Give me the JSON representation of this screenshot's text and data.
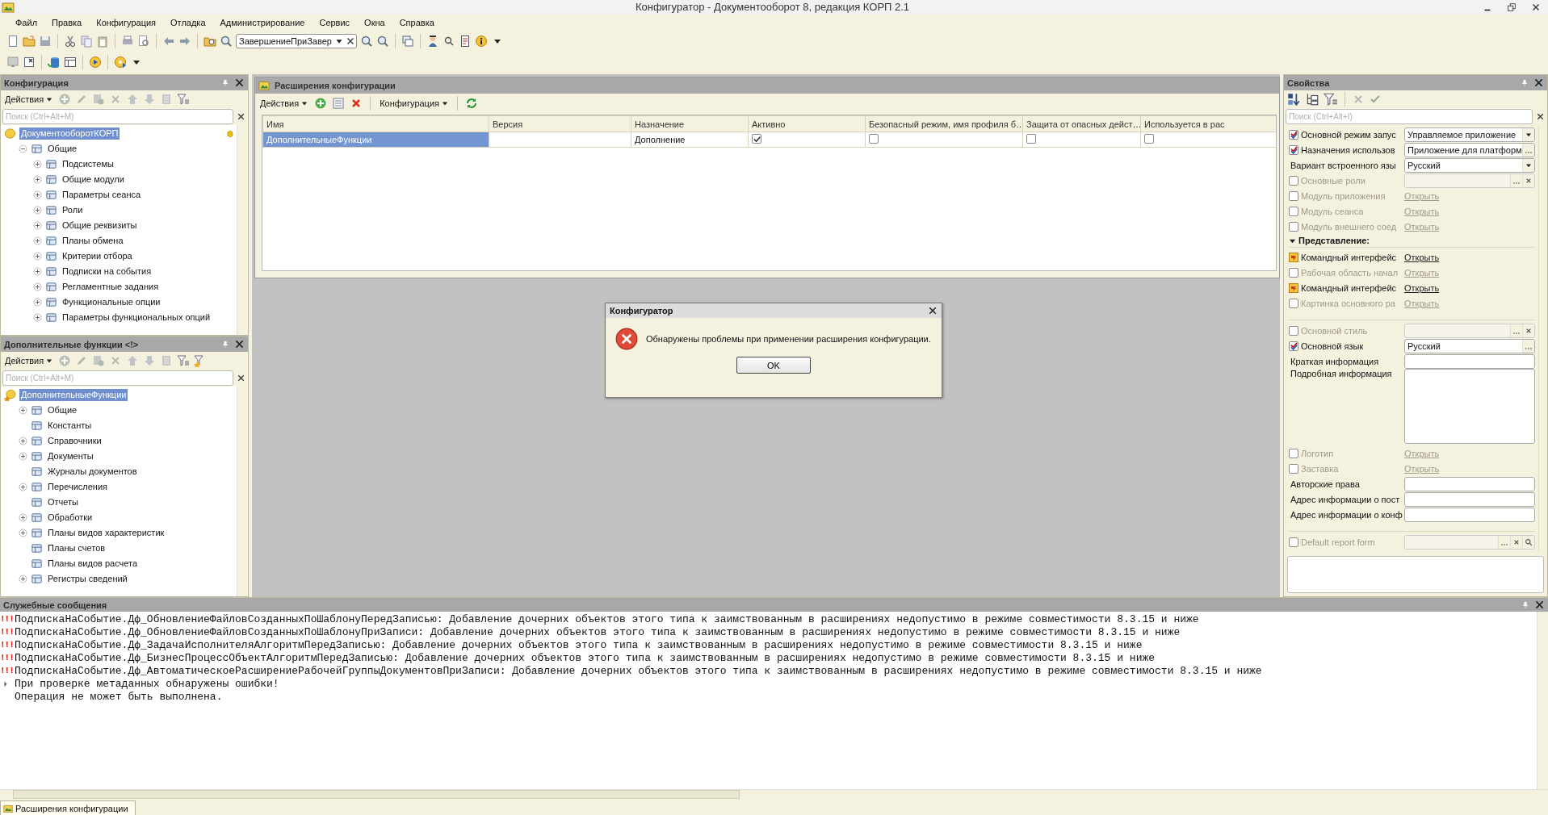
{
  "window": {
    "title": "Конфигуратор - Документооборот 8, редакция КОРП 2.1"
  },
  "menu": [
    "Файл",
    "Правка",
    "Конфигурация",
    "Отладка",
    "Администрирование",
    "Сервис",
    "Окна",
    "Справка"
  ],
  "toolbar": {
    "search": {
      "value": "ЗавершениеПриЗавер"
    }
  },
  "config_panel": {
    "title": "Конфигурация",
    "actions": "Действия",
    "search": {
      "placeholder": "Поиск (Ctrl+Alt+M)"
    },
    "tree": [
      {
        "label": "ДокументооборотКОРП",
        "selected": true,
        "expandable": false,
        "children": [
          {
            "label": "Общие",
            "selected": false,
            "expandable": true,
            "expanded": true,
            "children": [
              {
                "label": "Подсистемы",
                "selected": false,
                "expandable": true,
                "expanded": false
              },
              {
                "label": "Общие модули",
                "selected": false,
                "expandable": true,
                "expanded": false
              },
              {
                "label": "Параметры сеанса",
                "selected": false,
                "expandable": true,
                "expanded": false
              },
              {
                "label": "Роли",
                "selected": false,
                "expandable": true,
                "expanded": false
              },
              {
                "label": "Общие реквизиты",
                "selected": false,
                "expandable": true,
                "expanded": false
              },
              {
                "label": "Планы обмена",
                "selected": false,
                "expandable": true,
                "expanded": false
              },
              {
                "label": "Критерии отбора",
                "selected": false,
                "expandable": true,
                "expanded": false
              },
              {
                "label": "Подписки на события",
                "selected": false,
                "expandable": true,
                "expanded": false
              },
              {
                "label": "Регламентные задания",
                "selected": false,
                "expandable": true,
                "expanded": false
              },
              {
                "label": "Функциональные опции",
                "selected": false,
                "expandable": true,
                "expanded": false
              },
              {
                "label": "Параметры функциональных опций",
                "selected": false,
                "expandable": true,
                "expanded": false
              }
            ]
          }
        ]
      }
    ]
  },
  "extension_panel": {
    "title": "Дополнительные функции <!>",
    "actions": "Действия",
    "search": {
      "placeholder": "Поиск (Ctrl+Alt+M)"
    },
    "tree": [
      {
        "label": "ДополнительныеФункции",
        "selected": true,
        "expandable": false,
        "children": [
          {
            "label": "Общие",
            "selected": false,
            "expandable": true,
            "expanded": false
          },
          {
            "label": "Константы",
            "selected": false,
            "expandable": false
          },
          {
            "label": "Справочники",
            "selected": false,
            "expandable": true,
            "expanded": false
          },
          {
            "label": "Документы",
            "selected": false,
            "expandable": true,
            "expanded": false
          },
          {
            "label": "Журналы документов",
            "selected": false,
            "expandable": false
          },
          {
            "label": "Перечисления",
            "selected": false,
            "expandable": true,
            "expanded": false
          },
          {
            "label": "Отчеты",
            "selected": false,
            "expandable": false
          },
          {
            "label": "Обработки",
            "selected": false,
            "expandable": true,
            "expanded": false
          },
          {
            "label": "Планы видов характеристик",
            "selected": false,
            "expandable": true,
            "expanded": false
          },
          {
            "label": "Планы счетов",
            "selected": false,
            "expandable": false
          },
          {
            "label": "Планы видов расчета",
            "selected": false,
            "expandable": false
          },
          {
            "label": "Регистры сведений",
            "selected": false,
            "expandable": true,
            "expanded": false
          }
        ]
      }
    ]
  },
  "extensions_window": {
    "title": "Расширения конфигурации",
    "actions": "Действия",
    "configuration_menu": "Конфигурация",
    "table": {
      "columns": [
        "Имя",
        "Версия",
        "Назначение",
        "Активно",
        "Безопасный режим, имя профиля б…",
        "Защита от опасных дейст…",
        "Используется в рас"
      ],
      "rows": [
        {
          "selected": true,
          "name": "ДополнительныеФункции",
          "purpose": "Дополнение",
          "active": true,
          "safe_mode": false,
          "protection": false,
          "used": false
        }
      ]
    }
  },
  "dialog": {
    "title": "Конфигуратор",
    "message": "Обнаружены проблемы при применении расширения конфигурации.",
    "button": "OK"
  },
  "properties": {
    "title": "Свойства",
    "search": {
      "placeholder": "Поиск (Ctrl+Alt+I)"
    },
    "rows": [
      {
        "kind": "check",
        "checked": true,
        "disabled": false,
        "label": "Основной режим запус",
        "editor": {
          "kind": "select",
          "value": "Управляемое приложение"
        }
      },
      {
        "kind": "check",
        "checked": true,
        "disabled": false,
        "label": "Назначения использов",
        "editor": {
          "kind": "choice",
          "value": "Приложение для платформ"
        }
      },
      {
        "kind": "plain",
        "disabled": false,
        "label": "Вариант встроенного язы",
        "editor": {
          "kind": "select",
          "value": "Русский"
        }
      },
      {
        "kind": "check",
        "checked": false,
        "disabled": true,
        "label": "Основные роли",
        "editor": {
          "kind": "clear_choice"
        }
      },
      {
        "kind": "check",
        "checked": false,
        "disabled": true,
        "label": "Модуль приложения",
        "editor": {
          "kind": "link",
          "value": "Открыть"
        }
      },
      {
        "kind": "check",
        "checked": false,
        "disabled": true,
        "label": "Модуль сеанса",
        "editor": {
          "kind": "link",
          "value": "Открыть"
        }
      },
      {
        "kind": "check",
        "checked": false,
        "disabled": true,
        "label": "Модуль внешнего соед",
        "editor": {
          "kind": "link",
          "value": "Открыть"
        }
      },
      {
        "kind": "section",
        "expanded": true,
        "label": "Представление:"
      },
      {
        "kind": "edited",
        "disabled": false,
        "label": "Командный интерфейс",
        "editor": {
          "kind": "link",
          "value": "Открыть"
        }
      },
      {
        "kind": "check",
        "checked": false,
        "disabled": true,
        "label": "Рабочая область начал",
        "editor": {
          "kind": "link",
          "value": "Открыть"
        }
      },
      {
        "kind": "edited",
        "disabled": false,
        "label": "Командный интерфейс",
        "editor": {
          "kind": "link",
          "value": "Открыть"
        }
      },
      {
        "kind": "check",
        "checked": false,
        "disabled": true,
        "label": "Картинка основного ра",
        "editor": {
          "kind": "link",
          "value": "Открыть"
        }
      },
      {
        "kind": "separator"
      },
      {
        "kind": "check",
        "checked": false,
        "disabled": true,
        "label": "Основной стиль",
        "editor": {
          "kind": "clear_choice"
        }
      },
      {
        "kind": "check",
        "checked": true,
        "disabled": false,
        "label": "Основной язык",
        "editor": {
          "kind": "choice",
          "value": "Русский"
        }
      },
      {
        "kind": "plain",
        "disabled": false,
        "label": "Краткая информация",
        "editor": {
          "kind": "text"
        }
      },
      {
        "kind": "plain",
        "disabled": false,
        "label": "Подробная информация",
        "editor": {
          "kind": "textarea"
        }
      },
      {
        "kind": "check",
        "checked": false,
        "disabled": true,
        "label": "Логотип",
        "editor": {
          "kind": "link",
          "value": "Открыть"
        }
      },
      {
        "kind": "check",
        "checked": false,
        "disabled": true,
        "label": "Заставка",
        "editor": {
          "kind": "link",
          "value": "Открыть"
        }
      },
      {
        "kind": "plain",
        "disabled": false,
        "label": "Авторские права",
        "editor": {
          "kind": "text"
        }
      },
      {
        "kind": "plain",
        "disabled": false,
        "label": "Адрес информации о пост",
        "editor": {
          "kind": "text"
        }
      },
      {
        "kind": "plain",
        "disabled": false,
        "label": "Адрес информации о конф",
        "editor": {
          "kind": "text"
        }
      },
      {
        "kind": "separator"
      },
      {
        "kind": "check",
        "checked": false,
        "disabled": true,
        "label": "Default report form",
        "editor": {
          "kind": "search_choice"
        }
      }
    ]
  },
  "messages": {
    "title": "Служебные сообщения",
    "lines": [
      {
        "kind": "error",
        "marker": "!!!",
        "text": "ПодпискаНаСобытие.Дф_ОбновлениеФайловСозданныхПоШаблонуПередЗаписью: Добавление дочерних объектов этого типа к заимствованным в расширениях недопустимо в режиме совместимости 8.3.15 и ниже"
      },
      {
        "kind": "error",
        "marker": "!!!",
        "text": "ПодпискаНаСобытие.Дф_ОбновлениеФайловСозданныхПоШаблонуПриЗаписи: Добавление дочерних объектов этого типа к заимствованным в расширениях недопустимо в режиме совместимости 8.3.15 и ниже"
      },
      {
        "kind": "error",
        "marker": "!!!",
        "text": "ПодпискаНаСобытие.Дф_ЗадачаИсполнителяАлгоритмПередЗаписью: Добавление дочерних объектов этого типа к заимствованным в расширениях недопустимо в режиме совместимости 8.3.15 и ниже"
      },
      {
        "kind": "error",
        "marker": "!!!",
        "text": "ПодпискаНаСобытие.Дф_БизнесПроцессОбъектАлгоритмПередЗаписью: Добавление дочерних объектов этого типа к заимствованным в расширениях недопустимо в режиме совместимости 8.3.15 и ниже"
      },
      {
        "kind": "error",
        "marker": "!!!",
        "text": "ПодпискаНаСобытие.Дф_АвтоматическоеРасширениеРабочейГруппыДокументовПриЗаписи: Добавление дочерних объектов этого типа к заимствованным в расширениях недопустимо в режиме совместимости 8.3.15 и ниже"
      },
      {
        "kind": "info",
        "text": "При проверке метаданных обнаружены ошибки!"
      },
      {
        "kind": "plain",
        "text": "Операция не может быть выполнена."
      }
    ]
  },
  "taskbar": [
    {
      "label": "Расширения конфигурации",
      "selected": true
    }
  ]
}
